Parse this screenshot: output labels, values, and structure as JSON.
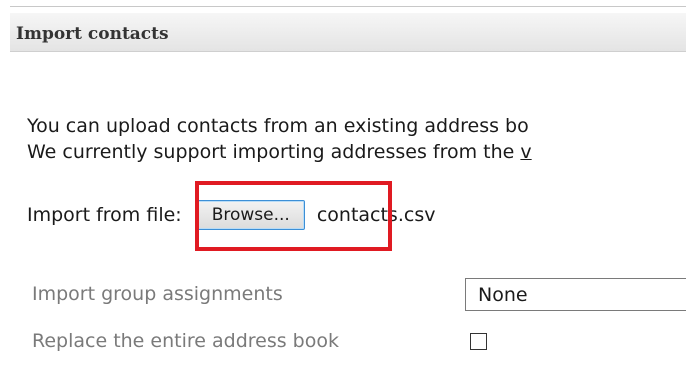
{
  "panel": {
    "title": "Import contacts"
  },
  "intro": {
    "line1": "You can upload contacts from an existing address bo",
    "line2_prefix": "We currently support importing addresses from the ",
    "line2_link": "v"
  },
  "file_row": {
    "label": "Import from file:",
    "browse_label": "Browse...",
    "file_name": "contacts.csv"
  },
  "options": {
    "group_assignments_label": "Import group assignments",
    "group_assignments_value": "None",
    "replace_label": "Replace the entire address book",
    "replace_checked": false
  },
  "colors": {
    "highlight": "#e01a22",
    "button_border": "#3c8fd6"
  }
}
